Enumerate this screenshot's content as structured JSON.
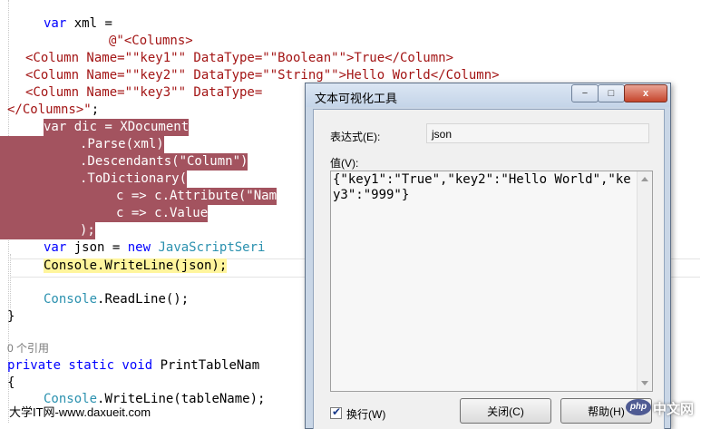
{
  "code": {
    "l1_kw": "var",
    "l1_rest": " xml =",
    "l2_str": "@\"<Columns>",
    "l3_str": "<Column Name=\"\"key1\"\" DataType=\"\"Boolean\"\">True</Column>",
    "l4_str": "<Column Name=\"\"key2\"\" DataType=\"\"String\"\">Hello World</Column>",
    "l5_str": "<Column Name=\"\"key3\"\" DataType=",
    "l6_str": "</Columns>\"",
    "l6_rest": ";",
    "l7": "var dic = XDocument",
    "l8": ".Parse(xml)",
    "l9": ".Descendants(\"Column\")",
    "l10": ".ToDictionary(",
    "l11": "c => c.Attribute(\"Nam",
    "l12": "c => c.Value",
    "l13": ");",
    "l14_kw1": "var",
    "l14_a": " json = ",
    "l14_kw2": "new",
    "l14_type": " JavaScriptSeri",
    "l15": "Console.WriteLine(json);",
    "l16": "Console.ReadLine();",
    "l17": "}",
    "refs": "0 个引用",
    "l18_kw": "private static void",
    "l18_rest": " PrintTableNam",
    "l19": "{",
    "l20": "Console.WriteLine(tableName);"
  },
  "dialog": {
    "title": "文本可视化工具",
    "min_glyph": "−",
    "max_glyph": "□",
    "close_glyph": "x",
    "expr_label": "表达式(E):",
    "expr_value": "json",
    "value_label": "值(V):",
    "value_text": "{\"key1\":\"True\",\"key2\":\"Hello World\",\"key3\":\"999\"}",
    "wrap_label": "换行(W)",
    "wrap_checked_glyph": "✔",
    "close_button": "关闭(C)",
    "help_button": "帮助(H)"
  },
  "watermarks": {
    "left": "大学IT网-www.daxueit.com",
    "php": "php",
    "cn": "中文网"
  }
}
